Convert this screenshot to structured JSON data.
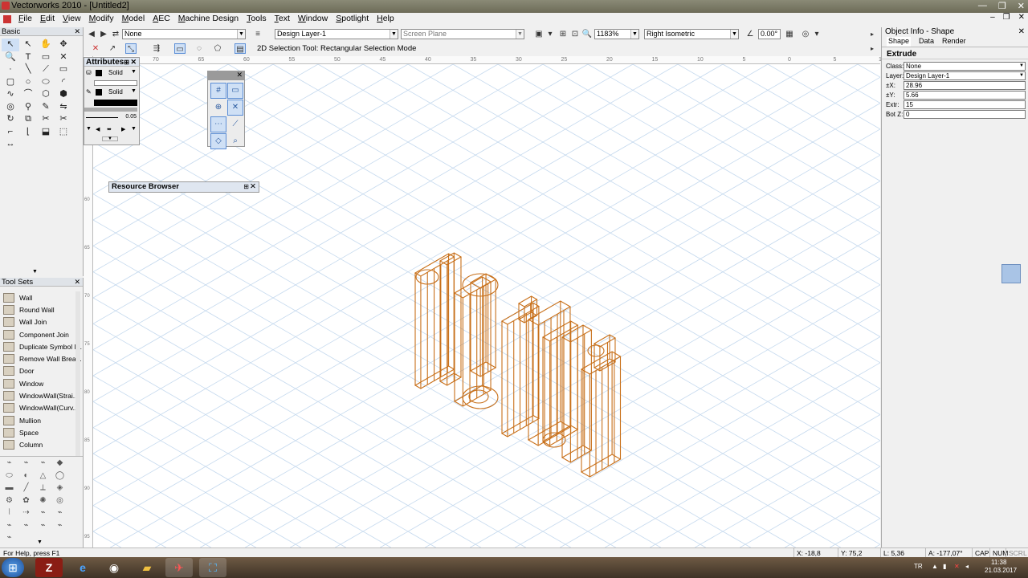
{
  "window": {
    "title": "Vectorworks 2010 - [Untitled2]"
  },
  "menu": [
    "File",
    "Edit",
    "View",
    "Modify",
    "Model",
    "AEC",
    "Machine Design",
    "Tools",
    "Text",
    "Window",
    "Spotlight",
    "Help"
  ],
  "toolbar": {
    "class_value": "None",
    "layer_value": "Design Layer-1",
    "plane_value": "Screen Plane",
    "zoom_value": "1183%",
    "view_value": "Right Isometric",
    "angle_value": "0.00°",
    "mode_label": "2D Selection Tool: Rectangular Selection Mode"
  },
  "palettes": {
    "basic_title": "Basic",
    "toolsets_title": "Tool Sets",
    "attributes_title": "Attributes",
    "resource_title": "Resource Browser",
    "fill_style": "Solid",
    "pen_style": "Solid",
    "line_weight": "0.05"
  },
  "toolsets": [
    "Wall",
    "Round Wall",
    "Wall Join",
    "Component Join",
    "Duplicate Symbol I...",
    "Remove Wall Brea...",
    "Door",
    "Window",
    "WindowWall(Strai...",
    "WindowWall(Curv...",
    "Mullion",
    "Space",
    "Column"
  ],
  "ruler_top": [
    "70",
    "65",
    "60",
    "55",
    "50",
    "45",
    "40",
    "35",
    "30",
    "25",
    "20",
    "15",
    "10",
    "5",
    "0",
    "5",
    "10"
  ],
  "ruler_left": [
    "60",
    "65",
    "70",
    "75",
    "80",
    "85",
    "90",
    "95"
  ],
  "objinfo": {
    "title": "Object Info - Shape",
    "tabs": [
      "Shape",
      "Data",
      "Render"
    ],
    "type": "Extrude",
    "fields": [
      {
        "label": "Class:",
        "value": "None",
        "dropdown": true
      },
      {
        "label": "Layer:",
        "value": "Design Layer-1",
        "dropdown": true
      },
      {
        "label": "±X:",
        "value": "28.96",
        "dropdown": false
      },
      {
        "label": "±Y:",
        "value": "5.66",
        "dropdown": false
      },
      {
        "label": "Extr:",
        "value": "15",
        "dropdown": false
      },
      {
        "label": "Bot Z:",
        "value": "0",
        "dropdown": false
      }
    ]
  },
  "status": {
    "help": "For Help, press F1",
    "x": "X: -18,8",
    "y": "Y: 75,2",
    "l": "L: 5,36",
    "a": "A: -177,07°",
    "caps": "CAP",
    "num": "NUM",
    "scrl": "SCRL"
  },
  "taskbar": {
    "lang": "TR",
    "time": "11:38",
    "date": "21.03.2017"
  },
  "colors": {
    "wireframe": "#c8701a",
    "grid": "#c5d9ee",
    "accent": "#5b8ed6"
  }
}
